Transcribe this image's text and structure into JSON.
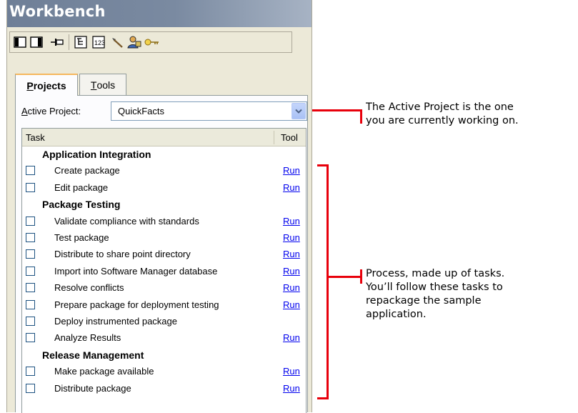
{
  "window": {
    "title": "Workbench"
  },
  "toolbar": {
    "icons": [
      "left-pane-icon",
      "right-pane-icon",
      "pin-icon",
      "tree-view-icon",
      "numbered-list-icon",
      "hammer-icon",
      "user-tools-icon",
      "key-icon"
    ]
  },
  "tabs": [
    {
      "pre": "",
      "accel": "P",
      "post": "rojects",
      "active": true
    },
    {
      "pre": "",
      "accel": "T",
      "post": "ools",
      "active": false
    }
  ],
  "active_project": {
    "label_accel": "A",
    "label_rest": "ctive Project:",
    "value": "QuickFacts"
  },
  "grid": {
    "col_task": "Task",
    "col_tool": "Tool",
    "groups": [
      {
        "title": "Application Integration",
        "tasks": [
          {
            "label": "Create package",
            "tool": "Run"
          },
          {
            "label": "Edit package",
            "tool": "Run"
          }
        ]
      },
      {
        "title": "Package Testing",
        "tasks": [
          {
            "label": "Validate compliance with standards",
            "tool": "Run"
          },
          {
            "label": "Test package",
            "tool": "Run"
          },
          {
            "label": "Distribute to share point directory",
            "tool": "Run"
          },
          {
            "label": "Import into Software Manager database",
            "tool": "Run"
          },
          {
            "label": "Resolve conflicts",
            "tool": "Run"
          },
          {
            "label": "Prepare package for deployment testing",
            "tool": "Run"
          },
          {
            "label": "Deploy instrumented package",
            "tool": ""
          },
          {
            "label": "Analyze Results",
            "tool": "Run"
          }
        ]
      },
      {
        "title": "Release Management",
        "tasks": [
          {
            "label": "Make package available",
            "tool": "Run"
          },
          {
            "label": "Distribute package",
            "tool": "Run"
          }
        ]
      }
    ]
  },
  "callouts": {
    "active_project_line1": "The Active Project is the one",
    "active_project_line2": "you are currently working on.",
    "process_line1": "Process, made up of tasks.",
    "process_line2": "You’ll follow these tasks to",
    "process_line3": "repackage the sample",
    "process_line4": "application."
  },
  "colors": {
    "callout_red": "#e8000b",
    "link_blue": "#0000ee",
    "title_bar": "#7a8aa1"
  }
}
